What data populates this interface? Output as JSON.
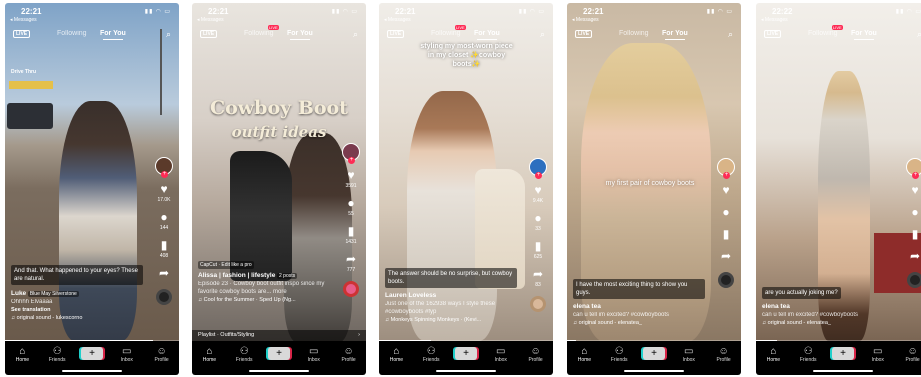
{
  "common": {
    "status_sub": "◂ Messages",
    "system_icons": "▮▮ ◠ ▭",
    "live_label": "LIVE",
    "following": "Following",
    "for_you": "For You",
    "live_badge": "LIVE",
    "search_icon": "search-icon",
    "tabs": [
      "Home",
      "Friends",
      "",
      "Inbox",
      "Profile"
    ],
    "create_glyph": "+"
  },
  "phones": [
    {
      "time": "22:21",
      "likes": "17.0K",
      "comments": "144",
      "saves": "408",
      "shares": "",
      "caption_box": "And that. What happened to your eyes? These are natural.",
      "user": "Luke",
      "tag": "Blue May Silverstone",
      "desc": "Ohhhh Elvaaaa",
      "translate": "See translation",
      "music": "♫ original sound - lukescorno",
      "sign": "Drive Thru"
    },
    {
      "time": "22:21",
      "likes": "3591",
      "comments": "55",
      "saves": "1431",
      "shares": "777",
      "overlay_title": "Cowboy Boot",
      "overlay_sub": "outfit ideas",
      "capcut": "CapCut · Edit like a pro",
      "user": "Alissa | fashion | lifestyle",
      "posts": "2 posts",
      "desc": "Episode 23 · Cowboy boot outfit inspo since my favorite cowboy boots are... more",
      "music": "♫ Cool for the Summer · Sped Up (Ng...",
      "playlist": "Playlist · Outfits/Styling"
    },
    {
      "time": "22:21",
      "likes": "9.4K",
      "comments": "33",
      "saves": "625",
      "shares": "83",
      "overlay_text": "styling my most-worn piece in my closet ✨cowboy boots✨",
      "caption_box": "The answer should be no surprise, but cowboy boots.",
      "user": "Lauren Loveless",
      "desc": "Just one of the 162938 ways I style these",
      "hashtags": "#cowboyboots #fyp",
      "music": "♫ Monkeys Spinning Monkeys · (Kevi..."
    },
    {
      "time": "22:21",
      "likes": "",
      "comments": "",
      "saves": "",
      "shares": "",
      "overlay_text": "my first pair of cowboy boots",
      "caption_box": "I have the most exciting thing to show you guys.",
      "user": "elena tea",
      "desc": "can u tell im excited? #cowboyboots",
      "music": "♫ original sound - elenatea_"
    },
    {
      "time": "22:22",
      "likes": "",
      "comments": "",
      "saves": "",
      "shares": "",
      "caption_box": "are you actually joking me?",
      "user": "elena tea",
      "desc": "can u tell im excited? #cowboyboots",
      "music": "♫ original sound - elenatea_"
    }
  ]
}
